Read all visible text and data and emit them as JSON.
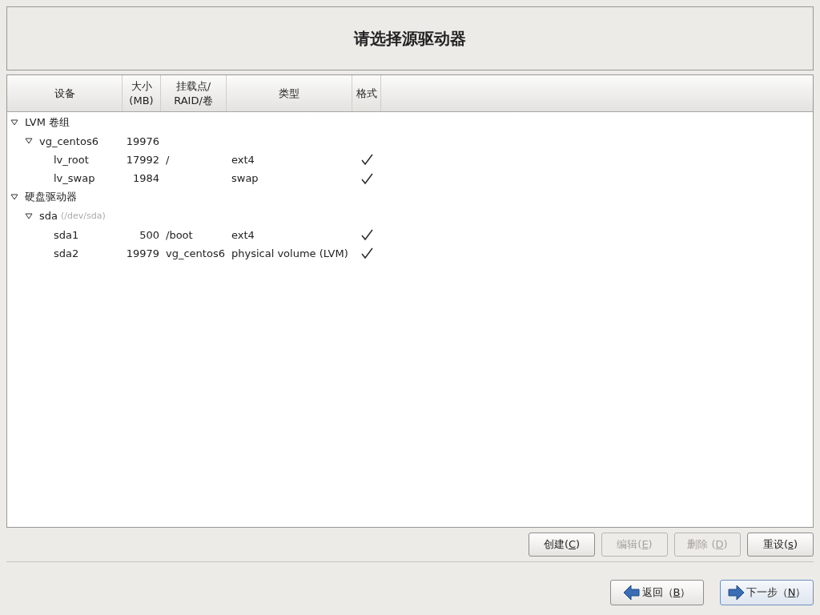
{
  "title": "请选择源驱动器",
  "columns": [
    {
      "lines": [
        "设备"
      ]
    },
    {
      "lines": [
        "大小",
        "(MB)"
      ]
    },
    {
      "lines": [
        "挂载点/",
        "RAID/卷"
      ]
    },
    {
      "lines": [
        "类型"
      ]
    },
    {
      "lines": [
        "格式"
      ]
    }
  ],
  "tree": [
    {
      "device": "LVM 卷组",
      "expanded": true,
      "children": [
        {
          "device": "vg_centos6",
          "size": "19976",
          "expanded": true,
          "children": [
            {
              "device": "lv_root",
              "size": "17992",
              "mount": "/",
              "type": "ext4",
              "format": true
            },
            {
              "device": "lv_swap",
              "size": "1984",
              "type": "swap",
              "format": true
            }
          ]
        }
      ]
    },
    {
      "device": "硬盘驱动器",
      "expanded": true,
      "children": [
        {
          "device": "sda",
          "note": "(/dev/sda)",
          "expanded": true,
          "children": [
            {
              "device": "sda1",
              "size": "500",
              "mount": "/boot",
              "type": "ext4",
              "format": true
            },
            {
              "device": "sda2",
              "size": "19979",
              "mount": "vg_centos6",
              "type": "physical volume (LVM)",
              "format": true
            }
          ]
        }
      ]
    }
  ],
  "actions": [
    {
      "before": "创建(",
      "key": "C",
      "after": ")",
      "disabled": false
    },
    {
      "before": "编辑(",
      "key": "E",
      "after": ")",
      "disabled": true
    },
    {
      "before": "删除 (",
      "key": "D",
      "after": ")",
      "disabled": true
    },
    {
      "before": "重设(",
      "key": "s",
      "after": ")",
      "disabled": false
    }
  ],
  "nav": [
    {
      "kind": "back",
      "before": "返回（",
      "key": "B",
      "after": "）",
      "focused": false
    },
    {
      "kind": "next",
      "before": "下一步（",
      "key": "N",
      "after": "）",
      "focused": true
    }
  ]
}
